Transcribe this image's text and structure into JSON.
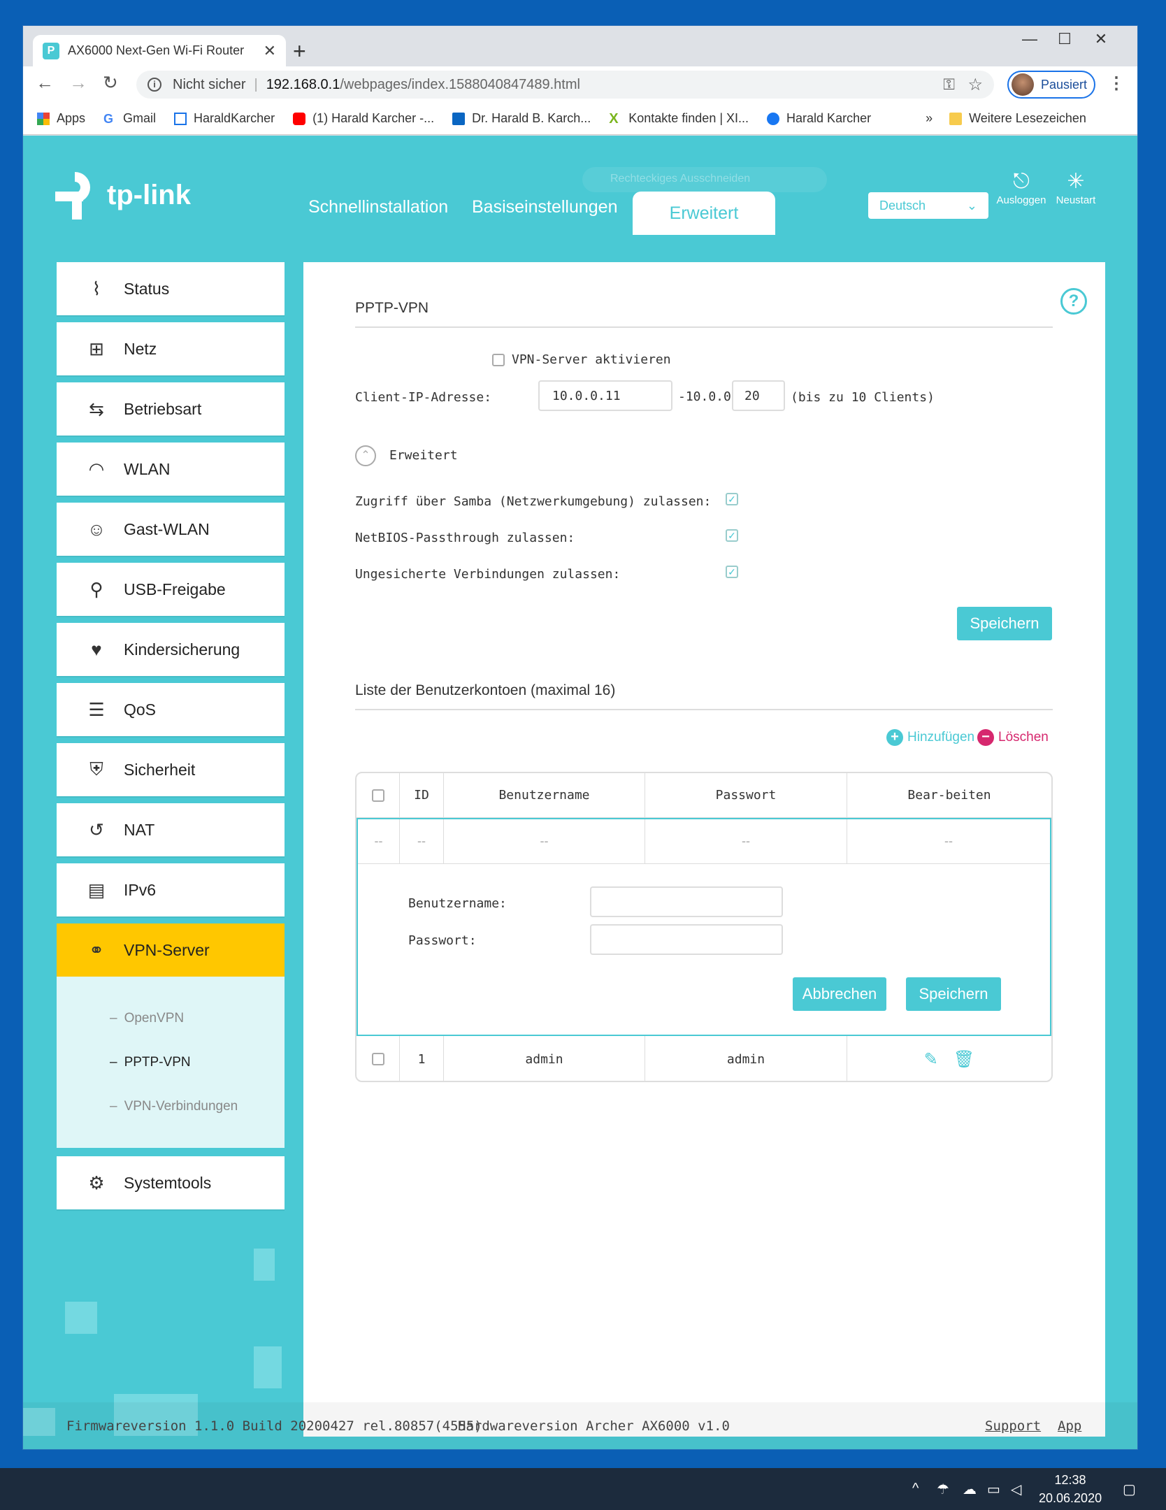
{
  "browser": {
    "tab_title": "AX6000 Next-Gen Wi-Fi Router",
    "tab_close": "✕",
    "new_tab": "+",
    "security_label": "Nicht sicher",
    "url_host": "192.168.0.1",
    "url_path": "/webpages/index.1588040847489.html",
    "profile_label": "Pausiert",
    "bookmarks": [
      {
        "label": "Apps"
      },
      {
        "label": "Gmail"
      },
      {
        "label": "HaraldKarcher"
      },
      {
        "label": "(1) Harald Karcher -..."
      },
      {
        "label": "Dr. Harald B. Karch..."
      },
      {
        "label": "Kontakte finden | XI..."
      },
      {
        "label": "Harald Karcher"
      }
    ],
    "bookmarks_more": "»",
    "other_bookmarks": "Weitere Lesezeichen"
  },
  "router": {
    "brand": "tp-link",
    "overlay_hint": "Rechteckiges Ausschneiden",
    "top_nav": {
      "quick_setup": "Schnellinstallation",
      "basic": "Basiseinstellungen",
      "advanced": "Erweitert"
    },
    "language": "Deutsch",
    "logout_label": "Ausloggen",
    "reboot_label": "Neustart",
    "sidebar": [
      {
        "label": "Status",
        "icon": "pulse-icon"
      },
      {
        "label": "Netz",
        "icon": "network-icon"
      },
      {
        "label": "Betriebsart",
        "icon": "mode-icon"
      },
      {
        "label": "WLAN",
        "icon": "wifi-icon"
      },
      {
        "label": "Gast-WLAN",
        "icon": "guests-icon"
      },
      {
        "label": "USB-Freigabe",
        "icon": "usb-icon"
      },
      {
        "label": "Kindersicherung",
        "icon": "parental-icon"
      },
      {
        "label": "QoS",
        "icon": "qos-icon"
      },
      {
        "label": "Sicherheit",
        "icon": "shield-icon"
      },
      {
        "label": "NAT",
        "icon": "nat-icon"
      },
      {
        "label": "IPv6",
        "icon": "ipv6-icon"
      },
      {
        "label": "VPN-Server",
        "icon": "link-icon"
      }
    ],
    "vpn_sub": [
      {
        "label": "OpenVPN"
      },
      {
        "label": "PPTP-VPN"
      },
      {
        "label": "VPN-Verbindungen"
      }
    ],
    "sub_dash": "–",
    "systemtools": "Systemtools",
    "pptp": {
      "title": "PPTP-VPN",
      "enable_label": "VPN-Server aktivieren",
      "enable_checked": false,
      "client_ip_label": "Client-IP-Adresse:",
      "ip_start": "10.0.0.11",
      "ip_mid": "-10.0.0.",
      "ip_end": "20",
      "ip_hint": "(bis zu 10 Clients)",
      "advanced_label": "Erweitert",
      "samba_label": "Zugriff über Samba (Netzwerkumgebung) zulassen:",
      "netbios_label": "NetBIOS-Passthrough zulassen:",
      "unsecured_label": "Ungesicherte Verbindungen zulassen:",
      "save_label": "Speichern"
    },
    "accounts": {
      "title": "Liste der Benutzerkontoen (maximal 16)",
      "add_label": "Hinzufügen",
      "delete_label": "Löschen",
      "columns": [
        "ID",
        "Benutzername",
        "Passwort",
        "Bear-beiten"
      ],
      "placeholder_row": [
        "--",
        "--",
        "--",
        "--",
        "--"
      ],
      "form_user_label": "Benutzername:",
      "form_pass_label": "Passwort:",
      "cancel_label": "Abbrechen",
      "save_label": "Speichern",
      "rows": [
        {
          "id": "1",
          "user": "admin",
          "pass": "admin"
        }
      ]
    },
    "footer": {
      "firmware": "Firmwareversion 1.1.0 Build 20200427 rel.80857(4555)",
      "hardware": "Hardwareversion Archer AX6000 v1.0",
      "support": "Support",
      "app": "App"
    }
  },
  "taskbar": {
    "time": "12:38",
    "date": "20.06.2020"
  },
  "colors": {
    "accent": "#4ac9d4",
    "active_menu": "#ffc700",
    "delete": "#d6286e"
  }
}
